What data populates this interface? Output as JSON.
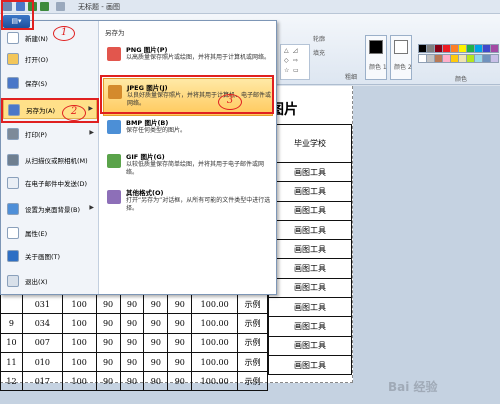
{
  "app": {
    "window_title": "无标题 - 画图"
  },
  "ribbon": {
    "tools": [
      "轮廓",
      "填充"
    ],
    "thickness_label": "粗细",
    "color1_label": "颜色 1",
    "color2_label": "颜色 2",
    "colors_group_label": "颜色",
    "palette": [
      "#000000",
      "#7f7f7f",
      "#880015",
      "#ed1c24",
      "#ff7f27",
      "#fff200",
      "#22b14c",
      "#00a2e8",
      "#3f48cc",
      "#a349a4",
      "#ffffff",
      "#c3c3c3",
      "#b97a57",
      "#ffaec9",
      "#ffc90e",
      "#efe4b0",
      "#b5e61d",
      "#99d9ea",
      "#7092be",
      "#c8bfe7"
    ]
  },
  "annotations": {
    "step1": "1",
    "step2": "2",
    "step3": "3"
  },
  "file_menu": {
    "items": [
      {
        "label": "新建(N)",
        "icon": "new-icon",
        "color": "#ffffff"
      },
      {
        "label": "打开(O)",
        "icon": "open-folder-icon",
        "color": "#f3c65a"
      },
      {
        "label": "保存(S)",
        "icon": "save-icon",
        "color": "#4a77c8"
      },
      {
        "label": "另存为(A)",
        "icon": "save-as-icon",
        "color": "#4a77c8",
        "arrow": "▶"
      },
      {
        "label": "打印(P)",
        "icon": "print-icon",
        "color": "#7d8a99",
        "arrow": "▶"
      },
      {
        "label": "从扫描仪或照相机(M)",
        "icon": "scanner-icon",
        "color": "#6f7f90"
      },
      {
        "label": "在电子邮件中发送(D)",
        "icon": "email-icon",
        "color": "#e9eef5"
      },
      {
        "label": "设置为桌面背景(B)",
        "icon": "desktop-icon",
        "color": "#4f8fd8",
        "arrow": "▶"
      },
      {
        "label": "属性(E)",
        "icon": "check-icon",
        "color": "#ffffff"
      },
      {
        "label": "关于画图(T)",
        "icon": "info-icon",
        "color": "#2e6fc4"
      },
      {
        "label": "退出(X)",
        "icon": "exit-icon",
        "color": "#d8e0ea"
      }
    ],
    "submenu_header": "另存为",
    "save_as_options": [
      {
        "title": "PNG 图片(P)",
        "desc": "以高质量保存照片或绘图，并将其用于计算机或网络。",
        "color": "#e2564d"
      },
      {
        "title": "JPEG 图片(J)",
        "desc": "以良好质量保存照片，并将其用于计算机、电子邮件或网络。",
        "color": "#d48a2c"
      },
      {
        "title": "BMP 图片(B)",
        "desc": "保存任何类型的图片。",
        "color": "#4c8fd6"
      },
      {
        "title": "GIF 图片(G)",
        "desc": "以较低质量保存简单绘图，并将其用于电子邮件或网络。",
        "color": "#5aa34a"
      },
      {
        "title": "其他格式(O)",
        "desc": "打开“另存为”对话框，从所有可能的文件类型中进行选择。",
        "color": "#8d6fb8"
      }
    ]
  },
  "canvas": {
    "title": "图片",
    "header_cell": "毕业学校",
    "right_rows": [
      "画图工具",
      "画图工具",
      "画图工具",
      "画图工具",
      "画图工具",
      "画图工具",
      "画图工具",
      "画图工具",
      "画图工具",
      "画图工具",
      "画图工具"
    ],
    "bottom_rows": [
      [
        "",
        "031",
        "100",
        "90",
        "90",
        "90",
        "90",
        "100.00",
        "示例"
      ],
      [
        "9",
        "034",
        "100",
        "90",
        "90",
        "90",
        "90",
        "100.00",
        "示例"
      ],
      [
        "10",
        "007",
        "100",
        "90",
        "90",
        "90",
        "90",
        "100.00",
        "示例"
      ],
      [
        "11",
        "010",
        "100",
        "90",
        "90",
        "90",
        "90",
        "100.00",
        "示例"
      ],
      [
        "12",
        "017",
        "100",
        "90",
        "90",
        "90",
        "90",
        "100.00",
        "示例"
      ]
    ]
  },
  "watermark": {
    "text": "Bai 经验"
  }
}
